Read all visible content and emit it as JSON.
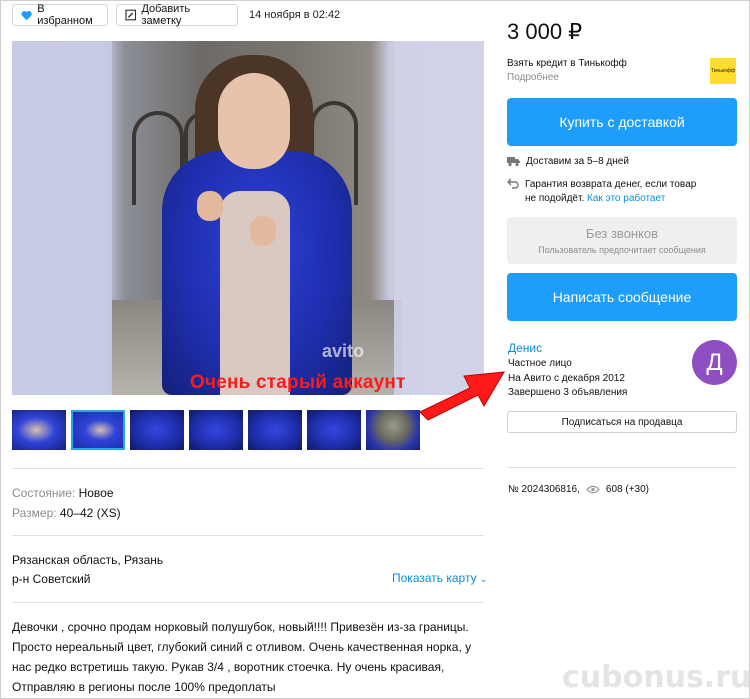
{
  "toolbar": {
    "favorite_label": "В избранном",
    "note_label": "Добавить заметку",
    "date": "14 ноября в 02:42"
  },
  "gallery": {
    "photo_watermark": "avito",
    "thumbnails": [
      "1",
      "2",
      "3",
      "4",
      "5",
      "6",
      "7"
    ],
    "selected_thumbnail": 2
  },
  "params": {
    "condition_label": "Состояние:",
    "condition_value": "Новое",
    "size_label": "Размер:",
    "size_value": "40–42 (XS)"
  },
  "location": {
    "line1": "Рязанская область, Рязань",
    "line2": "р-н Советский",
    "map_link": "Показать карту"
  },
  "description": [
    "Девочки , срочно продам норковый полушубок, новый!!!! Привезён из-за границы.",
    "Просто нереальный цвет, глубокий синий с отливом. Очень качественная норка, у",
    "нас редко встретишь такую. Рукав 3/4 , воротник стоечка. Ну очень красивая,",
    "Отправляю в регионы после 100% предоплаты"
  ],
  "sidebar": {
    "price": "3 000 ₽",
    "credit_title": "Взять кредит в Тинькофф",
    "credit_more": "Подробнее",
    "bank_logo_text": "Тинькофф",
    "buy_button": "Купить с доставкой",
    "delivery_text": "Доставим за 5–8 дней",
    "guarantee_line1": "Гарантия возврата денег, если товар",
    "guarantee_line2": "не подойдёт.",
    "guarantee_link": "Как это работает",
    "no_calls_title": "Без звонков",
    "no_calls_sub": "Пользователь предпочитает сообщения",
    "message_button": "Написать сообщение"
  },
  "seller": {
    "name": "Денис",
    "type": "Частное лицо",
    "since": "На Авито с декабря 2012",
    "completed": "Завершено 3 объявления",
    "avatar_letter": "Д",
    "subscribe_button": "Подписаться на продавца"
  },
  "stats": {
    "item_number": "№ 2024306816,",
    "views": "608 (+30)"
  },
  "annotation": {
    "text": "Очень старый аккаунт",
    "color": "#ff1a1a"
  },
  "site_watermark": "cubonus.ru",
  "colors": {
    "accent": "#1e9dfa",
    "link": "#0a8fd9",
    "avatar": "#8f4ec2"
  }
}
